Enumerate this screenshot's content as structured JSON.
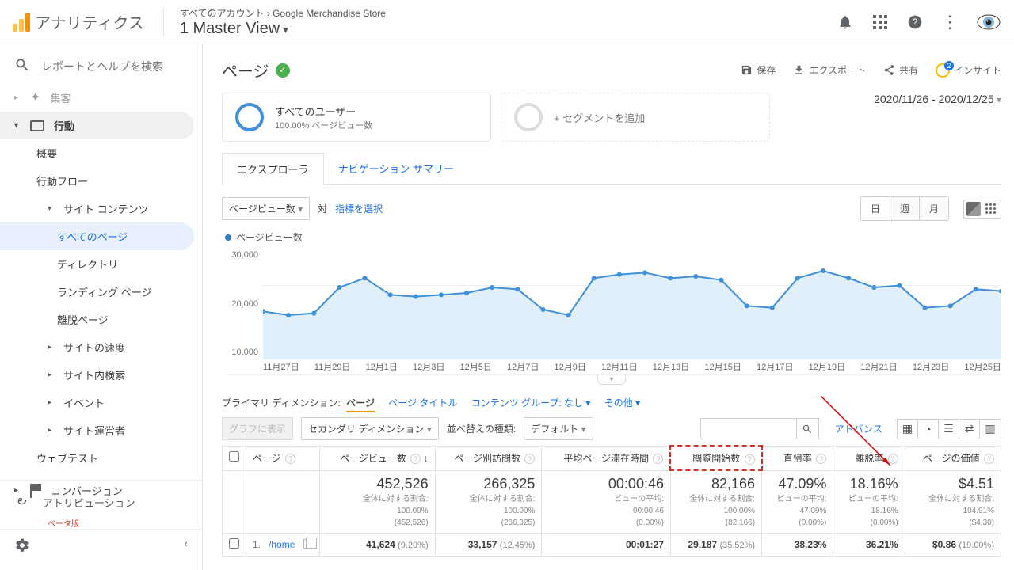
{
  "brand": "アナリティクス",
  "crumbs": {
    "all": "すべてのアカウント",
    "store": "Google Merchandise Store"
  },
  "view": "1 Master View",
  "search_placeholder": "レポートとヘルプを検索",
  "nav": {
    "behavior_top_cut": "集客",
    "behavior": "行動",
    "overview": "概要",
    "flow": "行動フロー",
    "site_content": "サイト コンテンツ",
    "all_pages": "すべてのページ",
    "directory": "ディレクトリ",
    "landing": "ランディング ページ",
    "exit_pages": "離脱ページ",
    "site_speed": "サイトの速度",
    "site_search": "サイト内検索",
    "events": "イベント",
    "publisher": "サイト運営者",
    "webtest": "ウェブテスト",
    "conversion": "コンバージョン",
    "attribution": "アトリビューション",
    "beta": "ベータ版"
  },
  "title": "ページ",
  "actions": {
    "save": "保存",
    "export": "エクスポート",
    "share": "共有",
    "insight": "インサイト"
  },
  "segment": {
    "all_users": "すべてのユーザー",
    "sub": "100.00% ページビュー数",
    "add": "+ セグメントを追加"
  },
  "date_range": "2020/11/26 - 2020/12/25",
  "tabs": {
    "explorer": "エクスプローラ",
    "nav_summary": "ナビゲーション サマリー"
  },
  "metric": {
    "pageviews": "ページビュー数",
    "vs": "対",
    "choose": "指標を選択"
  },
  "time_unit": {
    "day": "日",
    "week": "週",
    "month": "月"
  },
  "chart_legend": "ページビュー数",
  "chart_data": {
    "type": "area",
    "ylabel": "ページビュー数",
    "ylim": [
      0,
      30000
    ],
    "yticks": [
      30000,
      20000,
      10000
    ],
    "categories": [
      "11月27日",
      "11月29日",
      "12月1日",
      "12月3日",
      "12月5日",
      "12月7日",
      "12月9日",
      "12月11日",
      "12月13日",
      "12月15日",
      "12月17日",
      "12月19日",
      "12月21日",
      "12月23日",
      "12月25日"
    ],
    "values": [
      13000,
      12000,
      12500,
      19500,
      22000,
      17500,
      17000,
      17500,
      18000,
      19500,
      19000,
      13500,
      12000,
      22000,
      23000,
      23500,
      22000,
      22500,
      21500,
      14500,
      14000,
      22000,
      24000,
      22000,
      19500,
      20000,
      14000,
      14500,
      19000,
      18500
    ]
  },
  "prim_dim": {
    "label": "プライマリ ディメンション:",
    "active": "ページ",
    "page_title": "ページ タイトル",
    "content_group": "コンテンツ グループ: なし",
    "other": "その他"
  },
  "table_tools": {
    "plot": "グラフに表示",
    "secondary": "セカンダリ ディメンション",
    "sort": "並べ替えの種類:",
    "default": "デフォルト",
    "advance": "アドバンス"
  },
  "columns": {
    "page": "ページ",
    "pv": "ページビュー数",
    "upv": "ページ別訪問数",
    "avg": "平均ページ滞在時間",
    "entrances": "閲覧開始数",
    "bounce": "直帰率",
    "exit": "離脱率",
    "value": "ページの価値"
  },
  "summaries": {
    "pv": {
      "big": "452,526",
      "l1": "全体に対する割合:",
      "l2": "100.00%",
      "l3": "(452,526)"
    },
    "upv": {
      "big": "266,325",
      "l1": "全体に対する割合:",
      "l2": "100.00%",
      "l3": "(266,325)"
    },
    "avg": {
      "big": "00:00:46",
      "l1": "ビューの平均:",
      "l2": "00:00:46",
      "l3": "(0.00%)"
    },
    "ent": {
      "big": "82,166",
      "l1": "全体に対する割合:",
      "l2": "100.00%",
      "l3": "(82,166)"
    },
    "bnc": {
      "big": "47.09%",
      "l1": "ビューの平均:",
      "l2": "47.09%",
      "l3": "(0.00%)"
    },
    "ext": {
      "big": "18.16%",
      "l1": "ビューの平均:",
      "l2": "18.16%",
      "l3": "(0.00%)"
    },
    "val": {
      "big": "$4.51",
      "l1": "全体に対する割合:",
      "l2": "104.91%",
      "l3": "($4.30)"
    }
  },
  "row1": {
    "n": "1.",
    "path": "/home",
    "pv": "41,624",
    "pv_pct": "(9.20%)",
    "upv": "33,157",
    "upv_pct": "(12.45%)",
    "avg": "00:01:27",
    "ent": "29,187",
    "ent_pct": "(35.52%)",
    "bnc": "38.23%",
    "ext": "36.21%",
    "val": "$0.86",
    "val_pct": "(19.00%)"
  }
}
